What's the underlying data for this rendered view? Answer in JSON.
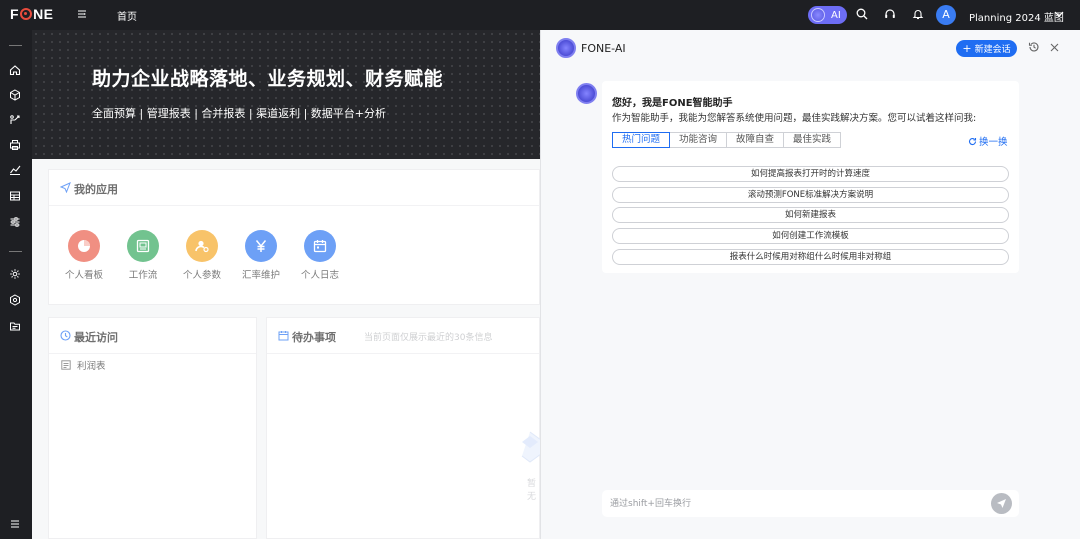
{
  "header": {
    "logo_left": "F",
    "logo_right": "NE",
    "home": "首页",
    "ai_label": "AI",
    "avatar_letter": "A",
    "org_name": "Planning 2024 蓝图"
  },
  "banner": {
    "title": "助力企业战略落地、业务规划、财务赋能",
    "subtitle": "全面预算 | 管理报表 | 合并报表 | 渠道返利 | 数据平台+分析"
  },
  "my_apps": {
    "title": "我的应用",
    "items": [
      {
        "label": "个人看板",
        "color": "#e8533f",
        "icon": "pie-icon"
      },
      {
        "label": "工作流",
        "color": "#27a354",
        "icon": "workflow-icon"
      },
      {
        "label": "个人参数",
        "color": "#f5a31a",
        "icon": "user-settings-icon"
      },
      {
        "label": "汇率维护",
        "color": "#1f6df2",
        "icon": "yen-icon"
      },
      {
        "label": "个人日志",
        "color": "#1f6df2",
        "icon": "calendar-icon"
      }
    ]
  },
  "recent": {
    "title": "最近访问",
    "items": [
      "利润表"
    ]
  },
  "todo": {
    "title": "待办事项",
    "hint": "当前页面仅展示最近的30条信息",
    "empty_text": "暂无"
  },
  "ai_panel": {
    "title": "FONE-AI",
    "new_chat": "新建会话",
    "greeting": "您好，我是FONE智能助手",
    "intro": "作为智能助手，我能为您解答系统使用问题，最佳实践解决方案。您可以试着这样问我:",
    "tabs": [
      "热门问题",
      "功能咨询",
      "故障自查",
      "最佳实践"
    ],
    "active_tab": 0,
    "refresh": "换一换",
    "questions": [
      "如何提高报表打开时的计算速度",
      "滚动预测FONE标准解决方案说明",
      "如何新建报表",
      "如何创建工作流模板",
      "报表什么时候用对称组什么时候用非对称组"
    ],
    "input_placeholder": "通过shift+回车换行"
  },
  "colors": {
    "accent": "#1f6df2",
    "ai_purple": "#6d6df5",
    "dark": "#1e1f23"
  }
}
